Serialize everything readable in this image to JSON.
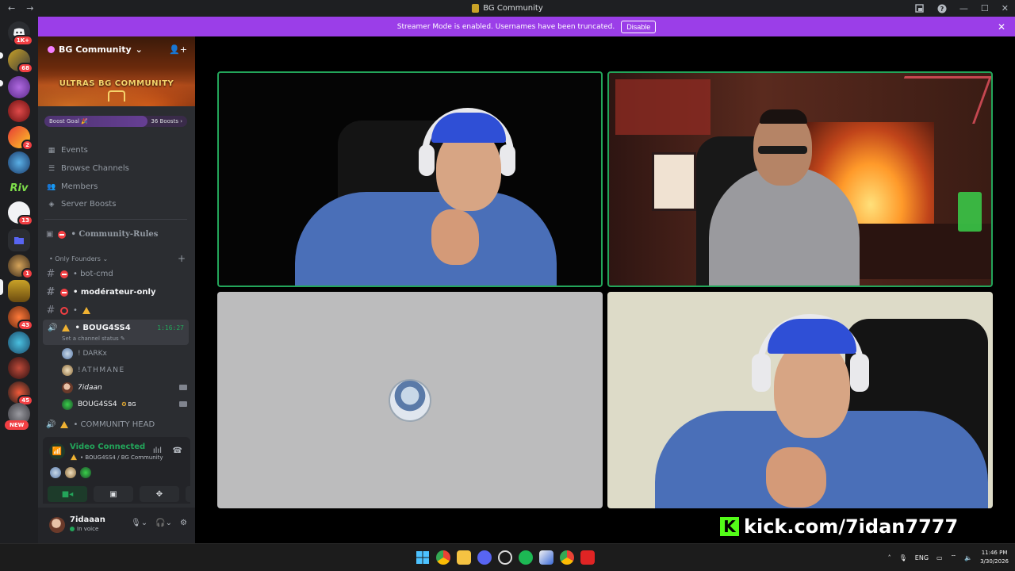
{
  "window": {
    "title": "BG Community",
    "back_glyph": "←",
    "forward_glyph": "→",
    "minimize_glyph": "—",
    "maximize_glyph": "☐",
    "close_glyph": "✕"
  },
  "rail": {
    "dm_badge": "1K+",
    "badges": [
      "68",
      "2",
      "13",
      "1",
      "43",
      "45"
    ],
    "new_label": "NEW"
  },
  "banner": {
    "message": "Streamer Mode is enabled. Usernames have been truncated.",
    "disable_label": "Disable",
    "bg_color": "#9b3ee8"
  },
  "guild": {
    "name": "BG Community",
    "banner_text": "ULTRAS BG COMMUNITY",
    "boost_goal_label": "Boost Goal 🎉",
    "boost_count": "36 Boosts",
    "boost_progress": 0.72
  },
  "menu": {
    "items": [
      {
        "label": "Events",
        "icon": "calendar-icon"
      },
      {
        "label": "Browse Channels",
        "icon": "browse-icon"
      },
      {
        "label": "Members",
        "icon": "members-icon"
      },
      {
        "label": "Server Boosts",
        "icon": "boost-icon"
      }
    ]
  },
  "channels": {
    "rules": "Community-Rules",
    "category": "Only Founders",
    "bot_cmd": "bot-cmd",
    "moderator_only": "modérateur-only",
    "active_voice": {
      "name": "BOUG4SS4",
      "timer": "1:16:27",
      "status": "Set a channel status"
    },
    "voice_users": [
      {
        "name": "! DARKx",
        "camera": false
      },
      {
        "name": "!ATHMANE",
        "camera": false
      },
      {
        "name": "7idaan",
        "camera": true
      },
      {
        "name": "BOUG4SS4",
        "tag": "BG",
        "camera": true
      }
    ],
    "next_voice": "COMMUNITY HEAD"
  },
  "voice_panel": {
    "title": "Video Connected",
    "subtitle": "BOUG4SS4 / BG Community",
    "accent": "#23a55a"
  },
  "user": {
    "name": "7idaaan",
    "status": "In voice"
  },
  "stream": {
    "overlay_text": "kick.com/7idan7777",
    "overlay_logo": "K",
    "kick_color": "#53fc18"
  },
  "taskbar": {
    "lang": "ENG",
    "time": "11:46 PM",
    "date": "3/30/2026"
  }
}
